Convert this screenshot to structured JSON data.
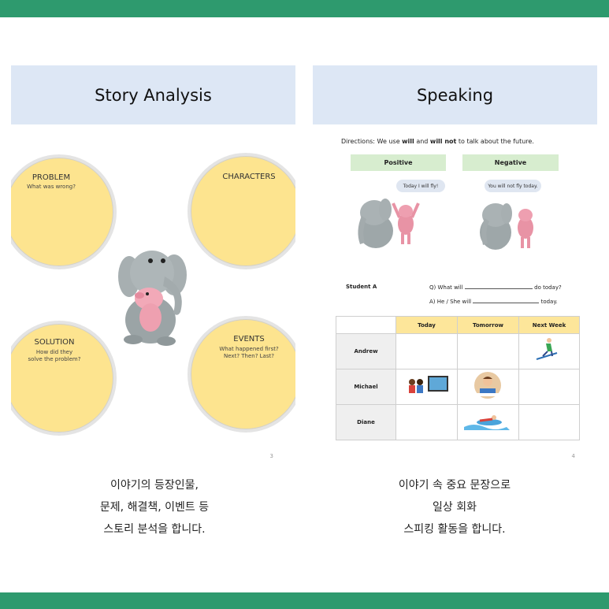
{
  "left_page": {
    "title": "Story Analysis",
    "page_number": "3",
    "problem": {
      "title": "PROBLEM",
      "sub": "What was wrong?"
    },
    "characters": {
      "title": "CHARACTERS"
    },
    "solution": {
      "title": "SOLUTION",
      "sub1": "How did they",
      "sub2": "solve the problem?"
    },
    "events": {
      "title": "EVENTS",
      "sub1": "What happened first?",
      "sub2": "Next? Then? Last?"
    }
  },
  "right_page": {
    "title": "Speaking",
    "page_number": "4",
    "directions": {
      "prefix": "Directions:  We use ",
      "will1": "will",
      "and": " and ",
      "will2": "will",
      "not": " not",
      "suffix": " to talk about the future."
    },
    "positive_label": "Positive",
    "negative_label": "Negative",
    "bubble_positive": "Today I will fly!",
    "bubble_negative": "You will not fly today.",
    "student_label": "Student A",
    "q_prefix": "Q) What will",
    "q_suffix": "do today?",
    "a_prefix": "A) He / She will",
    "a_suffix": "today.",
    "table": {
      "headers": [
        "Today",
        "Tomorrow",
        "Next Week"
      ],
      "rows": [
        "Andrew",
        "Michael",
        "Diane"
      ]
    }
  },
  "captions": {
    "left": [
      "이야기의 등장인물,",
      "문제, 해결책, 이벤트 등",
      "스토리 분석을 합니다."
    ],
    "right": [
      "이야기 속 중요 문장으로",
      "일상 회화",
      "스피킹 활동을 합니다."
    ]
  },
  "colors": {
    "band": "#2e9a6e",
    "header": "#dde7f5",
    "circle": "#fde48f",
    "pill": "#d7edcf",
    "table_header": "#fde69a"
  }
}
